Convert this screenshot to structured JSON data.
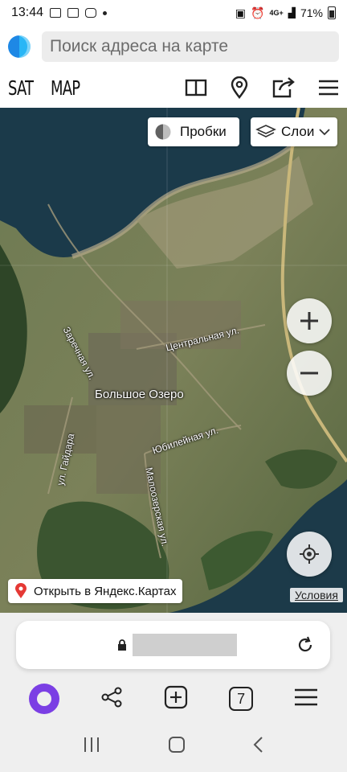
{
  "status": {
    "time": "13:44",
    "network": "4G+",
    "battery": "71%"
  },
  "search": {
    "placeholder": "Поиск адреса на карте"
  },
  "toolbar": {
    "brand_left": "SAT",
    "brand_right": "MAP"
  },
  "map": {
    "traffic_label": "Пробки",
    "layers_label": "Слои",
    "village_label": "Большое Озеро",
    "streets": [
      "Заречная ул.",
      "Центральная ул.",
      "ул. Гайдара",
      "Юбилейная ул.",
      "Малоозерская ул."
    ],
    "open_yandex_label": "Открыть в Яндекс.Картах",
    "terms_label": "Условия"
  },
  "browser": {
    "tabs_count": "7"
  },
  "colors": {
    "accent_purple": "#7b3fe4",
    "location_pin": "#e53935"
  }
}
